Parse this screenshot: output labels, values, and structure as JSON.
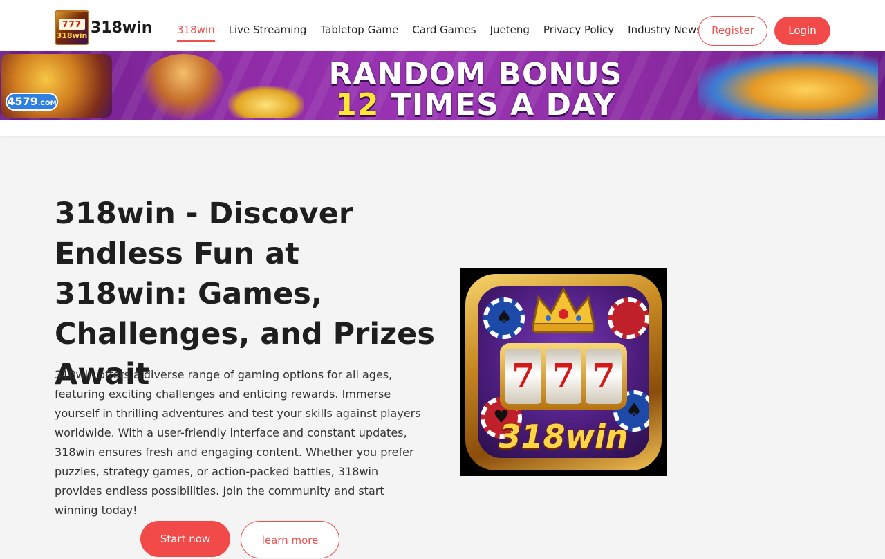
{
  "header": {
    "logo_icon_text": "777",
    "logo_icon_word": "318win",
    "logo_text": "318win",
    "nav": [
      {
        "label": "318win",
        "active": true
      },
      {
        "label": "Live Streaming"
      },
      {
        "label": "Tabletop Game"
      },
      {
        "label": "Card Games"
      },
      {
        "label": "Jueteng"
      },
      {
        "label": "Privacy Policy"
      },
      {
        "label": "Industry News"
      }
    ],
    "register_label": "Register",
    "login_label": "Login"
  },
  "banner": {
    "badge_text": "4579",
    "badge_sub": ".COM",
    "line1": "RANDOM BONUS",
    "line2_num": "12",
    "line2_rest": "TIMES A DAY"
  },
  "hero": {
    "title": "318win - Discover Endless Fun at 318win: Games, Challenges, and Prizes Await",
    "description": "318win offers a diverse range of gaming options for all ages, featuring exciting challenges and enticing rewards. Immerse yourself in thrilling adventures and test your skills against players worldwide. With a user-friendly interface and constant updates, 318win ensures fresh and engaging content. Whether you prefer puzzles, strategy games, or action-packed battles, 318win provides endless possibilities. Join the community and start winning today!",
    "start_label": "Start now",
    "learn_label": "learn more"
  },
  "app_icon": {
    "reels": [
      "7",
      "7",
      "7"
    ],
    "brand": "318win",
    "suits": [
      "♠",
      "♥",
      "♥",
      "♠"
    ]
  },
  "colors": {
    "accent": "#f24a48",
    "banner_purple": "#8e2aa6",
    "bonus_yellow": "#ffe534"
  }
}
